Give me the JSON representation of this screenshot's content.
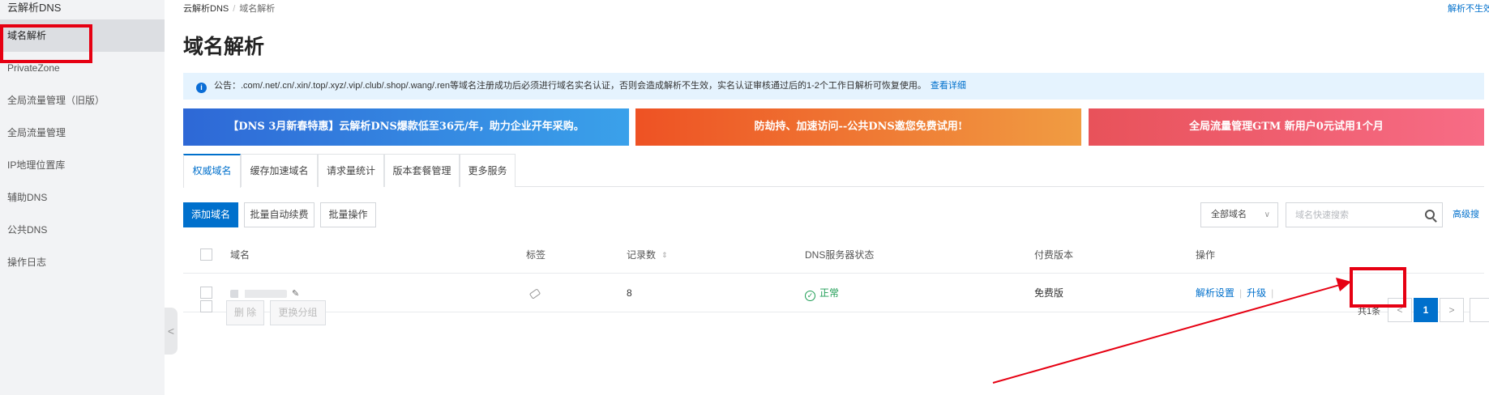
{
  "sidebar": {
    "title": "云解析DNS",
    "items": [
      {
        "label": "域名解析",
        "active": true
      },
      {
        "label": "PrivateZone"
      },
      {
        "label": "全局流量管理（旧版）"
      },
      {
        "label": "全局流量管理"
      },
      {
        "label": "IP地理位置库"
      },
      {
        "label": "辅助DNS"
      },
      {
        "label": "公共DNS"
      },
      {
        "label": "操作日志"
      }
    ],
    "collapse_glyph": "<"
  },
  "breadcrumb": {
    "root": "云解析DNS",
    "separator": "/",
    "current": "域名解析"
  },
  "top_right_link": "解析不生效",
  "page_title": "域名解析",
  "notice": {
    "icon": "i",
    "text": "公告：.com/.net/.cn/.xin/.top/.xyz/.vip/.club/.shop/.wang/.ren等域名注册成功后必须进行域名实名认证，否则会造成解析不生效，实名认证审核通过后的1-2个工作日解析可恢复使用。",
    "link": "查看详细"
  },
  "banners": [
    {
      "text": "【DNS 3月新春特惠】云解析DNS爆款低至36元/年，助力企业开年采购。"
    },
    {
      "text": "防劫持、加速访问--公共DNS邀您免费试用!"
    },
    {
      "text": "全局流量管理GTM 新用户0元试用1个月"
    }
  ],
  "tabs": [
    {
      "label": "权威域名",
      "active": true
    },
    {
      "label": "缓存加速域名"
    },
    {
      "label": "请求量统计"
    },
    {
      "label": "版本套餐管理"
    },
    {
      "label": "更多服务"
    }
  ],
  "toolbar": {
    "add_label": "添加域名",
    "batch_renew_label": "批量自动续费",
    "batch_ops_label": "批量操作",
    "filter_value": "全部域名",
    "search_placeholder": "域名快速搜索",
    "advanced_link": "高级搜"
  },
  "table": {
    "columns": [
      "域名",
      "标签",
      "记录数",
      "DNS服务器状态",
      "付费版本",
      "操作"
    ],
    "rows": [
      {
        "record_count": "8",
        "dns_status": "正常",
        "plan": "免费版",
        "actions": [
          "解析设置",
          "升级"
        ]
      }
    ]
  },
  "footer": {
    "delete_label": "删 除",
    "change_group_label": "更换分组",
    "total_text": "共1条",
    "prev_glyph": "<",
    "current_page": "1",
    "next_glyph": ">"
  },
  "colors": {
    "accent": "#0070cc",
    "highlight": "#e60012",
    "success": "#1f9d55"
  }
}
